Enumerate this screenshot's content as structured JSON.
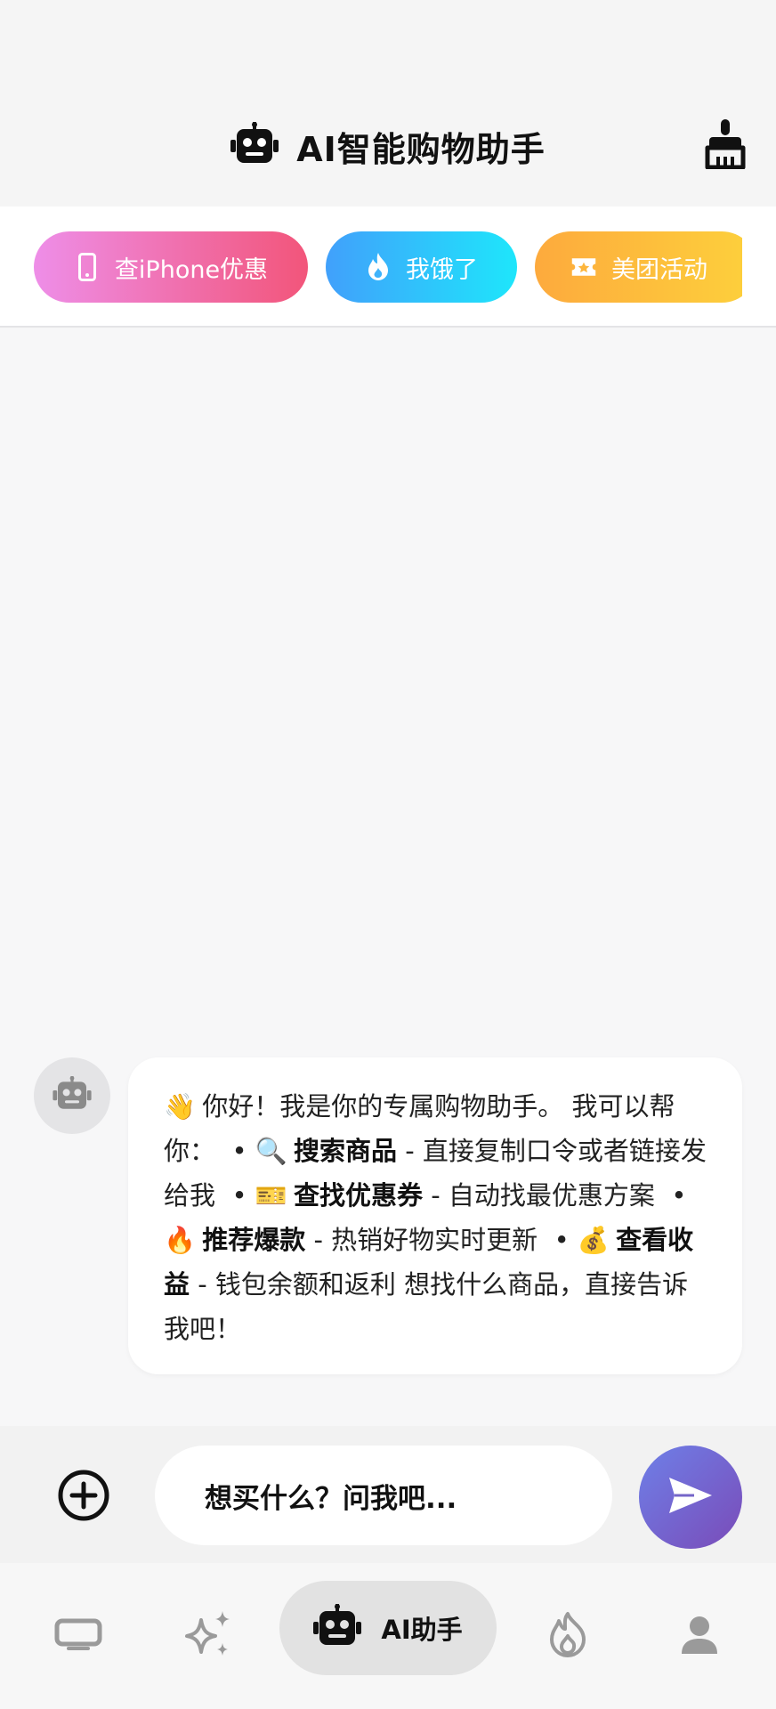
{
  "header": {
    "title": "AI智能购物助手",
    "robot_icon": "robot-icon",
    "clear_icon": "broom-icon"
  },
  "quick_chips": [
    {
      "label": "查iPhone优惠",
      "icon": "phone-icon",
      "colors": [
        "#ee8ee8",
        "#f2557a"
      ]
    },
    {
      "label": "我饿了",
      "icon": "flame-icon",
      "colors": [
        "#41a0fb",
        "#1ee6fb"
      ]
    },
    {
      "label": "美团活动",
      "icon": "ticket-icon",
      "colors": [
        "#fdaa3d",
        "#fdd13c"
      ]
    }
  ],
  "chat": {
    "bot_message": {
      "greeting_emoji": "👋",
      "greeting": "你好！我是你的专属购物助手。 我可以帮你：",
      "items": [
        {
          "emoji": "🔍",
          "title": "搜索商品",
          "desc": "- 直接复制口令或者链接发给我"
        },
        {
          "emoji": "🎫",
          "title": "查找优惠券",
          "desc": "- 自动找最优惠方案"
        },
        {
          "emoji": "🔥",
          "title": "推荐爆款",
          "desc": "- 热销好物实时更新"
        },
        {
          "emoji": "💰",
          "title": "查看收益",
          "desc": "- 钱包余额和返利"
        }
      ],
      "closing": "想找什么商品，直接告诉我吧！"
    }
  },
  "input": {
    "placeholder": "想买什么？问我吧...",
    "add_icon": "plus-circle-icon",
    "send_icon": "send-icon"
  },
  "bottom_nav": {
    "items": [
      {
        "icon": "tv-icon",
        "label": ""
      },
      {
        "icon": "sparkles-icon",
        "label": ""
      },
      {
        "icon": "robot-icon",
        "label": "AI助手",
        "active": true
      },
      {
        "icon": "fire-icon",
        "label": ""
      },
      {
        "icon": "user-icon",
        "label": ""
      }
    ]
  },
  "colors": {
    "accent_send": "#6e80e8",
    "chip_pink": "#f2557a",
    "chip_blue": "#41a0fb",
    "chip_orange": "#fdaa3d"
  }
}
